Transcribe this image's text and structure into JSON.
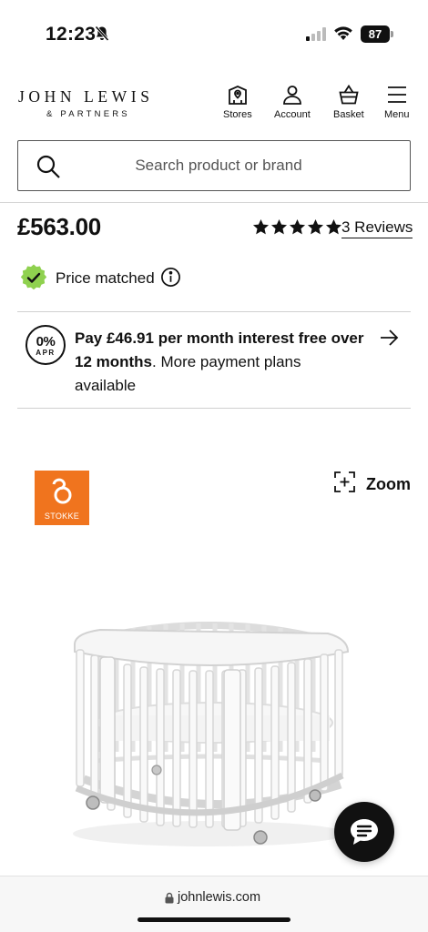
{
  "status_bar": {
    "time": "12:23",
    "battery": "87",
    "icons": [
      "silent-bell-icon",
      "cellular-signal-icon",
      "wifi-icon",
      "battery-icon"
    ]
  },
  "header": {
    "logo_line1": "JOHN LEWIS",
    "logo_line2": "& PARTNERS",
    "nav": [
      {
        "label": "Stores",
        "icon": "store-icon"
      },
      {
        "label": "Account",
        "icon": "account-icon"
      },
      {
        "label": "Basket",
        "icon": "basket-icon"
      },
      {
        "label": "Menu",
        "icon": "hamburger-menu-icon"
      }
    ]
  },
  "search": {
    "placeholder": "Search product or brand",
    "value": ""
  },
  "product": {
    "price": "£563.00",
    "rating": 5,
    "reviews_label": "3 Reviews",
    "price_matched_label": "Price matched",
    "finance": {
      "badge_pct": "0%",
      "badge_label": "APR",
      "bold_line": "Pay £46.91 per month interest free over 12 months",
      "rest": ". More payment plans available"
    },
    "brand_logo_name": "STOKKE",
    "zoom_label": "Zoom"
  },
  "browser": {
    "url": "johnlewis.com"
  },
  "colors": {
    "brand_orange": "#f0741e",
    "price_match_green": "#8fd14f",
    "text": "#111111"
  }
}
